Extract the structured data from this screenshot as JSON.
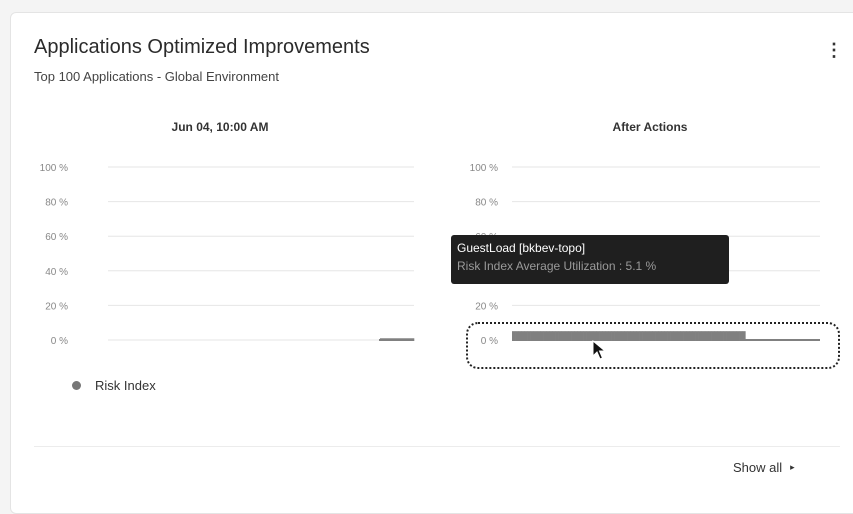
{
  "card": {
    "title": "Applications Optimized Improvements",
    "subtitle": "Top 100 Applications - Global Environment",
    "menu_icon": "kebab-menu-icon",
    "show_all_label": "Show all",
    "show_all_arrow": "▸"
  },
  "tooltip": {
    "title": "GuestLoad [bkbev-topo]",
    "detail": "Risk Index Average Utilization : 5.1 %"
  },
  "legend": {
    "label": "Risk Index",
    "color": "#777777"
  },
  "chart_data": [
    {
      "type": "bar",
      "title": "Jun 04, 10:00 AM",
      "y_ticks": [
        "100 %",
        "80 %",
        "60 %",
        "40 %",
        "20 %",
        "0 %"
      ],
      "ylim": [
        0,
        100
      ],
      "series": [
        {
          "values": [
            0,
            0,
            0,
            0,
            0,
            0,
            0,
            0,
            1
          ]
        }
      ],
      "color": "#808080",
      "grid": true
    },
    {
      "type": "bar",
      "title": "After Actions",
      "y_ticks": [
        "100 %",
        "80 %",
        "60 %",
        "40 %",
        "20 %",
        "0 %"
      ],
      "ylim": [
        0,
        100
      ],
      "series": [
        {
          "values": [
            5.1,
            5.1,
            5.1,
            5.1,
            5.1,
            5.1,
            5.1,
            5.1,
            5.1,
            5.1,
            5.1,
            5.1,
            5.1,
            5.1,
            5.1,
            5.1,
            5.1,
            5.1,
            5.1,
            5.1,
            5.1,
            5.1,
            5.1,
            5.1,
            5.1,
            5.1,
            5.1,
            5.1,
            5.1,
            5.1,
            5.1,
            5.1,
            5.1,
            5.1,
            5.1,
            5.1,
            5.1,
            5.1,
            5.1,
            5.1,
            5.1,
            5.1,
            5.1,
            5.1,
            5.1,
            5.1,
            5.1,
            5.1,
            5.1,
            5.1,
            5.1,
            5.1,
            5.1,
            5.1,
            5.1,
            5.1,
            5.1,
            5.1,
            5.1,
            5.1,
            5.1,
            5.1,
            5.1,
            5.1,
            5.1,
            5.1,
            5.1,
            5.1,
            5.1,
            5.1,
            5.1,
            5.1,
            5.1,
            5.1,
            5.1,
            0,
            0,
            0,
            0,
            0,
            0,
            0,
            0,
            0,
            0,
            0,
            0,
            0,
            0,
            0,
            0,
            0,
            0,
            0,
            0,
            0,
            0,
            0,
            0
          ]
        }
      ],
      "color": "#808080",
      "grid": true
    }
  ]
}
